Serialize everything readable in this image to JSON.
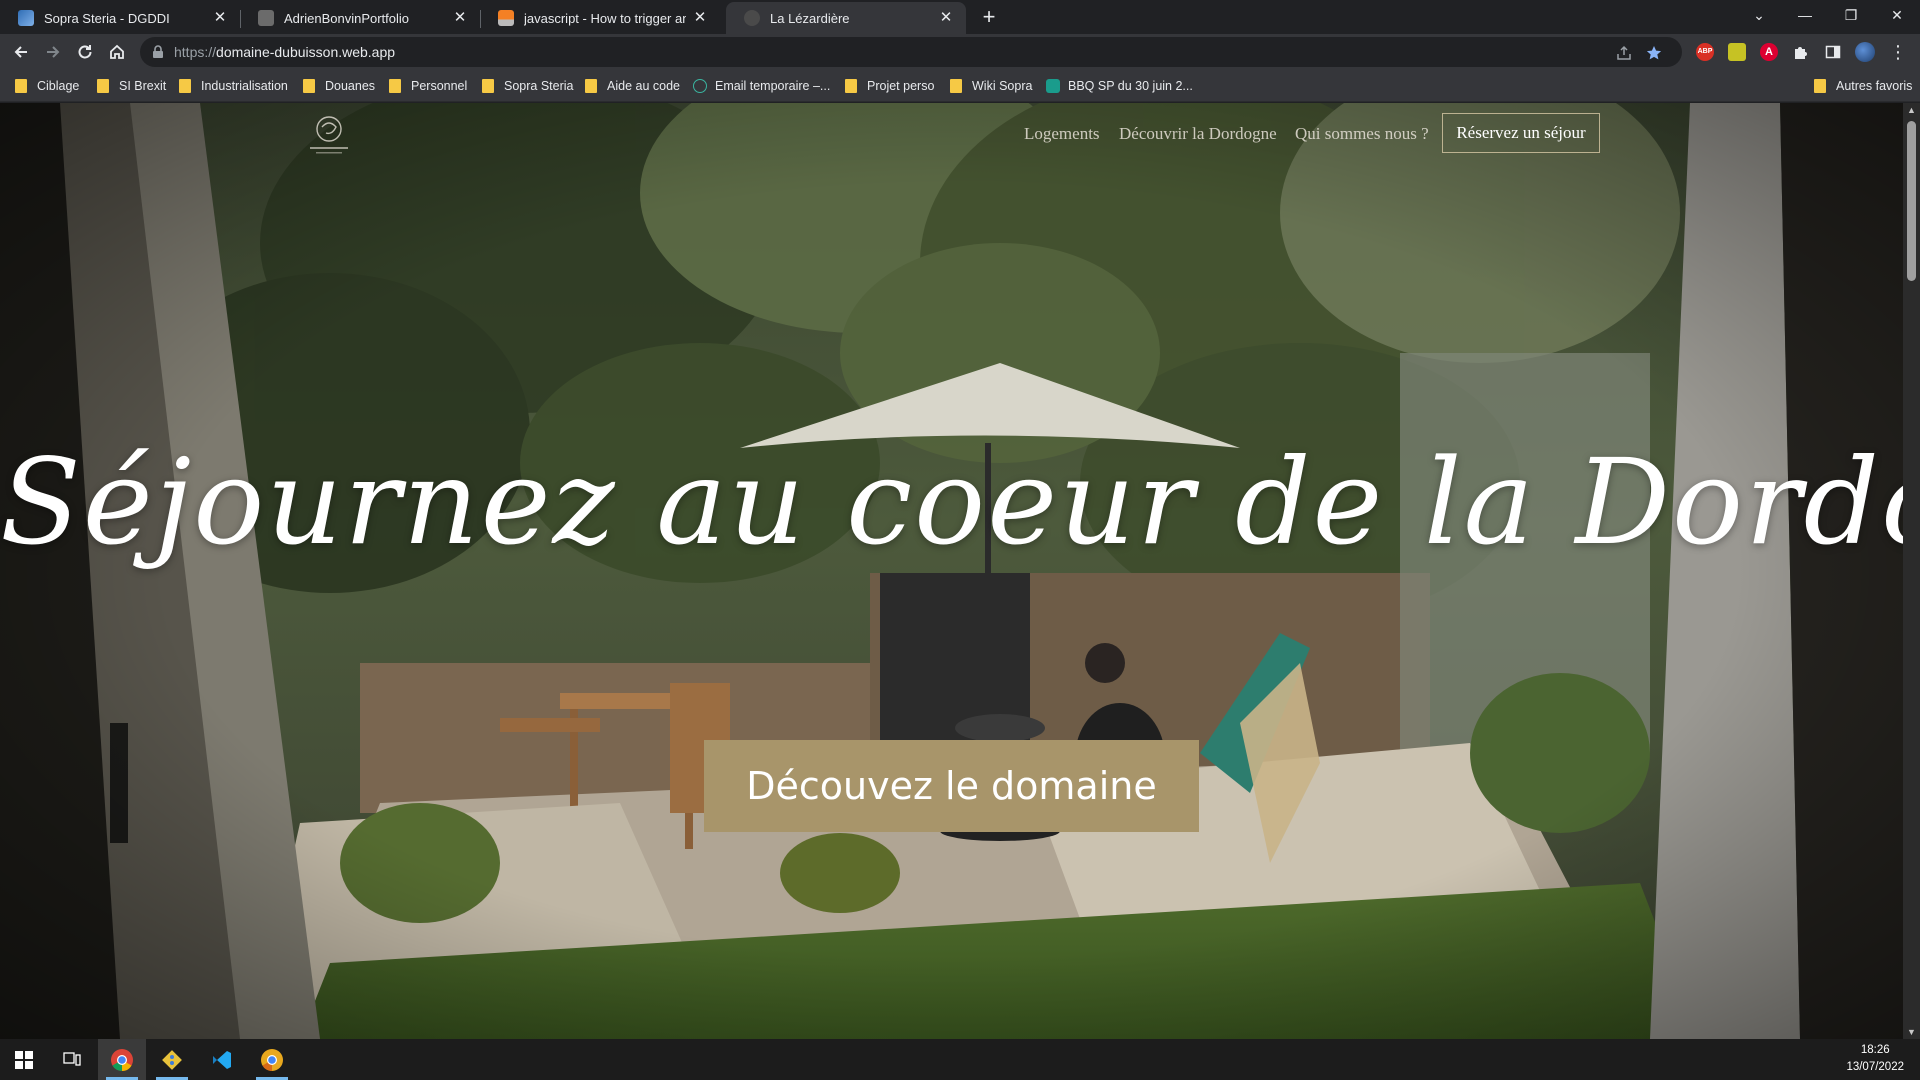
{
  "browser": {
    "tabs": [
      {
        "title": "Sopra Steria - DGDDI",
        "icon": "sopra-steria-favicon",
        "active": false
      },
      {
        "title": "AdrienBonvinPortfolio",
        "icon": "portfolio-favicon",
        "active": false
      },
      {
        "title": "javascript - How to trigger anima",
        "icon": "stackoverflow-favicon",
        "active": false
      },
      {
        "title": "La Lézardière",
        "icon": "lizard-favicon",
        "active": true
      }
    ],
    "new_tab_icon": "plus-icon",
    "window_controls": [
      "chevron-down-icon",
      "minimize-icon",
      "restore-icon",
      "close-icon"
    ],
    "address": {
      "scheme": "https://",
      "host": "domaine-dubuisson.web.app"
    },
    "toolbar_icons": [
      "back-icon",
      "forward-icon",
      "reload-icon",
      "home-icon",
      "lock-icon",
      "share-icon",
      "star-icon",
      "abp-extension-icon",
      "extension-icon",
      "angular-extension-icon",
      "puzzle-icon",
      "sidepanel-icon",
      "profile-icon",
      "more-icon"
    ],
    "extension_labels": {
      "abp": "ABP",
      "angular": "A"
    },
    "bookmarks": [
      {
        "label": "Ciblage",
        "type": "folder"
      },
      {
        "label": "SI Brexit",
        "type": "folder"
      },
      {
        "label": "Industrialisation",
        "type": "folder"
      },
      {
        "label": "Douanes",
        "type": "folder"
      },
      {
        "label": "Personnel",
        "type": "folder"
      },
      {
        "label": "Sopra Steria",
        "type": "folder"
      },
      {
        "label": "Aide au code",
        "type": "folder"
      },
      {
        "label": "Email temporaire –...",
        "type": "link"
      },
      {
        "label": "Projet perso",
        "type": "folder"
      },
      {
        "label": "Wiki Sopra",
        "type": "folder"
      },
      {
        "label": "BBQ SP du 30 juin 2...",
        "type": "link"
      }
    ],
    "other_bookmarks": "Autres favoris"
  },
  "site": {
    "logo_icon": "lizard-logo-icon",
    "nav": {
      "links": [
        "Logements",
        "Découvrir la Dordogne",
        "Qui sommes nous ?"
      ],
      "book_button": "Réservez un séjour"
    },
    "hero": {
      "title": "Séjournez au coeur de la Dordogne",
      "cta": "Découvez le domaine"
    },
    "colors": {
      "accent": "#a8956a",
      "nav_text": "#e6e1d7"
    }
  },
  "taskbar": {
    "apps": [
      "windows-start-icon",
      "task-view-icon",
      "chrome-icon",
      "git-icon",
      "vscode-icon",
      "chrome-canary-icon"
    ],
    "time": "18:26",
    "date": "13/07/2022"
  }
}
